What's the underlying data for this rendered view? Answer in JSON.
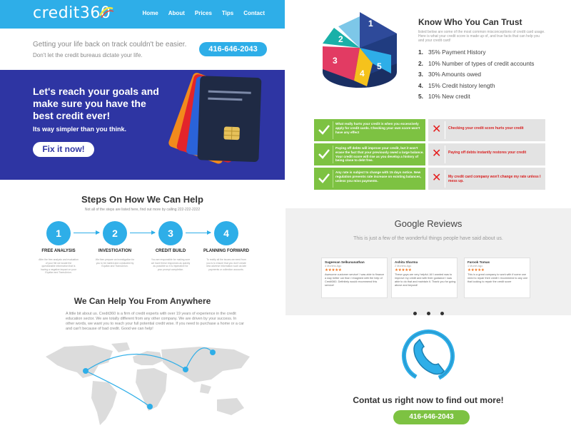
{
  "nav": {
    "logo": "credit360",
    "links": [
      "Home",
      "About",
      "Prices",
      "Tips",
      "Contact"
    ]
  },
  "hero": {
    "line1": "Getting your life back on track couldn't be easier.",
    "line2": "Don't let the credit bureaus dictate your life.",
    "phone": "416-646-2043"
  },
  "banner": {
    "heading": "Let's reach your goals and make sure you have the best credit ever!",
    "sub": "Its way simpler than you think.",
    "button": "Fix it now!"
  },
  "steps": {
    "title": "Steps On How We Can Help",
    "sub": "Not all of the steps are listed here, find out more by calling 222-222-2222",
    "items": [
      {
        "num": "1",
        "label": "FREE ANALYSIS",
        "desc": "After the free analysis and evaluation of your file we locate the questionable information that is having a negative impact on your Equifax and TransUnion."
      },
      {
        "num": "2",
        "label": "INVESTIGATION",
        "desc": "We then prepare an investigation for you to be mailed and conducted by Equifax and TransUnion."
      },
      {
        "num": "3",
        "label": "CREDIT BUILD",
        "desc": "You are responsible for making sure we have these responses as quickly as possible so it is imperative for your prompt completion."
      },
      {
        "num": "4",
        "label": "PLANNING FORWARD",
        "desc": "To rectify all the issues we need from you is to ensure that you don't create new adverse information such as late payments or collection accounts."
      }
    ]
  },
  "help": {
    "title": "We Can Help You From Anywhere",
    "body": "A little bit about us. Credit360 is a firm of credit experts with over 19 years of experience in the credit education sector. We are totally different from any other company. We are driven by your success. In other words, we want you to reach your full potential credit wise. If you need to purchase a home or a car and can't because of bad credit. Good we can help!"
  },
  "trust": {
    "title": "Know Who You Can Trust",
    "body": "listed below are some of the most common misconceptions of credit card usage. Here is what your credit score is made up of, and true facts that can help you and your credit card!",
    "list": [
      {
        "num": "1.",
        "text": "35% Payment History"
      },
      {
        "num": "2.",
        "text": "10% Number of types of credit accounts"
      },
      {
        "num": "3.",
        "text": "30% Amounts owed"
      },
      {
        "num": "4.",
        "text": "15% Credit history length"
      },
      {
        "num": "5.",
        "text": "10% New credit"
      }
    ],
    "pie_labels": [
      "1",
      "2",
      "3",
      "4",
      "5"
    ]
  },
  "myths": [
    {
      "truth": "What really hurts your credit is when you excessively apply for credit cards. Checking your own score won't have any effect",
      "myth": "Checking your credit score hurts your credit"
    },
    {
      "truth": "Paying off debts will improve your credit, but it won't erase the fact that your previously owed a large balance. Your credit score will rise as you develop a history of being close to debt free.",
      "myth": "Paying off debts instantly restores your credit"
    },
    {
      "truth": "Any rate is subject to change with 15 days notice. New regulation prevents rate increase on existing balances, unless you miss payments.",
      "myth": "My credit card company won't change my rate unless I mess up."
    }
  ],
  "reviews": {
    "title": "Google Reviews",
    "sub": "This is just a few of the wonderful things people have said about us.",
    "stars": "★★★★★",
    "items": [
      {
        "name": "Sugeevan Selkunanathan",
        "date": "4 Months Ago",
        "text": "Awesome customer service! I was able to finance a way better car than I imagined with the help of Credit360. Definitely would recommend this service!"
      },
      {
        "name": "Ashita Sharma",
        "date": "2 Months Ago",
        "text": "These guys are very helpful. All I wanted was to improve my credit and with their guidance I was able to do that and maintain it. Thank you for going above and beyond!"
      },
      {
        "name": "Farook Tomas",
        "date": "1 Month Ago",
        "text": "This is a great company to work with if some one need to repair their credit I recommend to any one that looking to repair the credit score"
      }
    ]
  },
  "contact": {
    "title": "Contat us right now to find out more!",
    "phone": "416-646-2043"
  },
  "colors": {
    "brand_blue": "#2eaee8",
    "banner_navy": "#2e35a3",
    "green": "#7dc242",
    "red": "#e51d1d"
  }
}
